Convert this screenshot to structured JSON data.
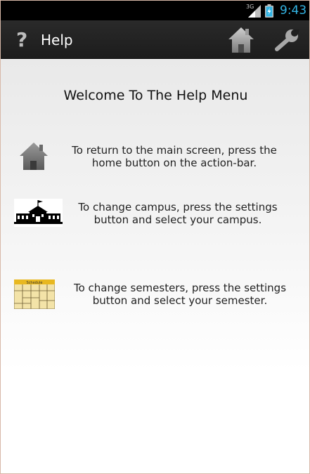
{
  "status_bar": {
    "network": "3G",
    "time": "9:43",
    "accent_color": "#33b5e5"
  },
  "action_bar": {
    "icon": "help-icon",
    "icon_glyph": "?",
    "title": "Help",
    "actions": [
      {
        "name": "home",
        "icon": "home-icon"
      },
      {
        "name": "settings",
        "icon": "wrench-icon"
      }
    ]
  },
  "content": {
    "heading": "Welcome To The Help Menu",
    "items": [
      {
        "icon": "home-icon",
        "text": "To return to the main screen, press the home button on the action-bar."
      },
      {
        "icon": "school-building-icon",
        "text": "To change campus, press the settings button and select your campus."
      },
      {
        "icon": "schedule-icon",
        "icon_label": "Schedule",
        "text": "To change semesters, press the settings button and select your semester."
      }
    ]
  }
}
